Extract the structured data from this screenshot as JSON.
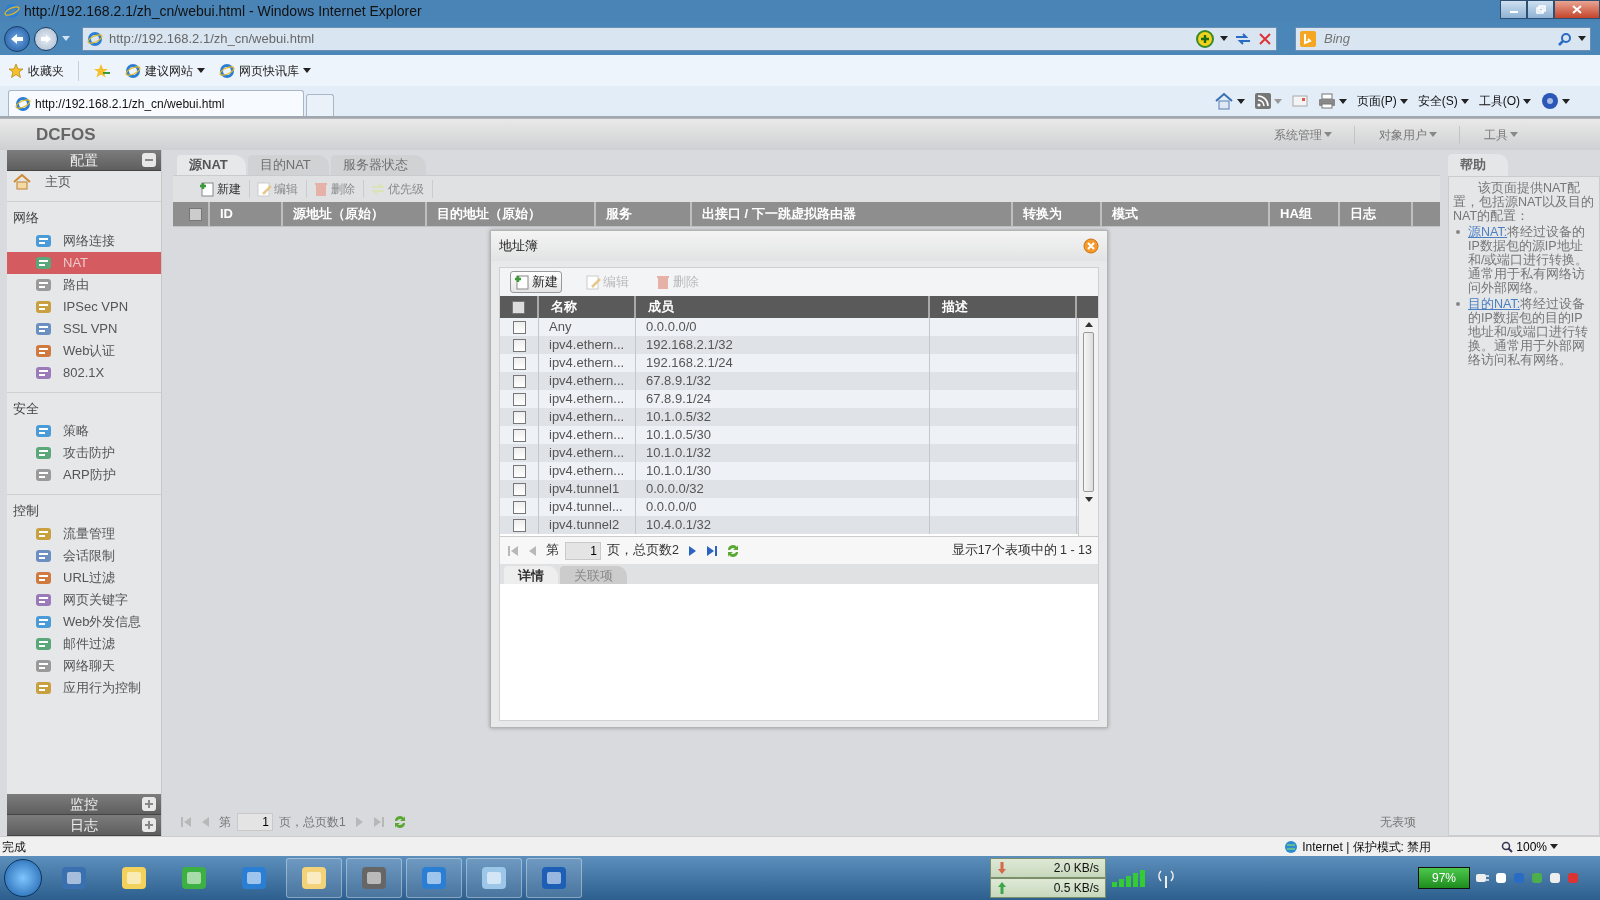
{
  "window": {
    "title": "http://192.168.2.1/zh_cn/webui.html - Windows Internet Explorer"
  },
  "address_bar": {
    "url": "http://192.168.2.1/zh_cn/webui.html"
  },
  "search": {
    "placeholder": "Bing"
  },
  "favorites_bar": [
    {
      "label": "收藏夹",
      "dropdown": false
    },
    {
      "label": "建议网站",
      "dropdown": true
    },
    {
      "label": "网页快讯库",
      "dropdown": true
    }
  ],
  "browser_tabs": [
    {
      "label": "http://192.168.2.1/zh_cn/webui.html",
      "selected": true
    }
  ],
  "command_bar": [
    "页面(P)",
    "安全(S)",
    "工具(O)"
  ],
  "app": {
    "logo": "DCFOS",
    "menus": [
      "系统管理",
      "对象用户",
      "工具"
    ]
  },
  "sidebar": {
    "panels": [
      {
        "title": "配置",
        "expanded": true,
        "home": "主页",
        "groups": [
          {
            "title": "网络",
            "items": [
              {
                "label": "网络连接",
                "selected": false
              },
              {
                "label": "NAT",
                "selected": true
              },
              {
                "label": "路由",
                "selected": false
              },
              {
                "label": "IPSec VPN",
                "selected": false
              },
              {
                "label": "SSL VPN",
                "selected": false
              },
              {
                "label": "Web认证",
                "selected": false
              },
              {
                "label": "802.1X",
                "selected": false
              }
            ]
          },
          {
            "title": "安全",
            "items": [
              {
                "label": "策略",
                "selected": false
              },
              {
                "label": "攻击防护",
                "selected": false
              },
              {
                "label": "ARP防护",
                "selected": false
              }
            ]
          },
          {
            "title": "控制",
            "items": [
              {
                "label": "流量管理",
                "selected": false
              },
              {
                "label": "会话限制",
                "selected": false
              },
              {
                "label": "URL过滤",
                "selected": false
              },
              {
                "label": "网页关键字",
                "selected": false
              },
              {
                "label": "Web外发信息",
                "selected": false
              },
              {
                "label": "邮件过滤",
                "selected": false
              },
              {
                "label": "网络聊天",
                "selected": false
              },
              {
                "label": "应用行为控制",
                "selected": false
              }
            ]
          }
        ]
      },
      {
        "title": "监控",
        "expanded": false
      },
      {
        "title": "日志",
        "expanded": false
      }
    ]
  },
  "tabs": [
    {
      "label": "源NAT",
      "selected": true
    },
    {
      "label": "目的NAT",
      "selected": false
    },
    {
      "label": "服务器状态",
      "selected": false
    }
  ],
  "toolbar": [
    {
      "label": "新建",
      "disabled": false
    },
    {
      "label": "编辑",
      "disabled": true
    },
    {
      "label": "删除",
      "disabled": true
    },
    {
      "label": "优先级",
      "disabled": true
    }
  ],
  "table": {
    "select_all_checked": false,
    "columns": [
      "ID",
      "源地址（原始）",
      "目的地址（原始）",
      "服务",
      "出接口 / 下一跳虚拟路由器",
      "转换为",
      "模式",
      "HA组",
      "日志"
    ]
  },
  "pager": {
    "prefix": "第",
    "page": "1",
    "suffix": "页，总页数1",
    "summary": "无表项",
    "nav": [
      {
        "kind": "first",
        "disabled": true
      },
      {
        "kind": "prev",
        "disabled": true
      },
      {
        "kind": "next",
        "disabled": true
      },
      {
        "kind": "last",
        "disabled": true
      }
    ]
  },
  "help": {
    "title": "帮助",
    "intro": "该页面提供NAT配置，包括源NAT以及目的NAT的配置：",
    "items": [
      {
        "link": "源NAT:",
        "text": "将经过设备的IP数据包的源IP地址和/或端口进行转换。通常用于私有网络访问外部网络。"
      },
      {
        "link": "目的NAT:",
        "text": "将经过设备的IP数据包的目的IP地址和/或端口进行转换。通常用于外部网络访问私有网络。"
      }
    ]
  },
  "dialog": {
    "title": "地址簿",
    "toolbar": [
      {
        "label": "新建",
        "disabled": false
      },
      {
        "label": "编辑",
        "disabled": true
      },
      {
        "label": "删除",
        "disabled": true
      }
    ],
    "select_all_checked": false,
    "columns": [
      "名称",
      "成员",
      "描述"
    ],
    "rows": [
      {
        "name": "Any",
        "member": "0.0.0.0/0",
        "checked": false
      },
      {
        "name": "ipv4.ethern...",
        "member": "192.168.2.1/32",
        "checked": false
      },
      {
        "name": "ipv4.ethern...",
        "member": "192.168.2.1/24",
        "checked": false
      },
      {
        "name": "ipv4.ethern...",
        "member": "67.8.9.1/32",
        "checked": false
      },
      {
        "name": "ipv4.ethern...",
        "member": "67.8.9.1/24",
        "checked": false
      },
      {
        "name": "ipv4.ethern...",
        "member": "10.1.0.5/32",
        "checked": false
      },
      {
        "name": "ipv4.ethern...",
        "member": "10.1.0.5/30",
        "checked": false
      },
      {
        "name": "ipv4.ethern...",
        "member": "10.1.0.1/32",
        "checked": false
      },
      {
        "name": "ipv4.ethern...",
        "member": "10.1.0.1/30",
        "checked": false
      },
      {
        "name": "ipv4.tunnel1",
        "member": "0.0.0.0/32",
        "checked": false
      },
      {
        "name": "ipv4.tunnel...",
        "member": "0.0.0.0/0",
        "checked": false
      },
      {
        "name": "ipv4.tunnel2",
        "member": "10.4.0.1/32",
        "checked": false
      }
    ],
    "pager": {
      "prefix": "第",
      "page": "1",
      "suffix": "页，总页数2",
      "summary": "显示17个表项中的 1 - 13",
      "nav": [
        {
          "kind": "first",
          "disabled": true
        },
        {
          "kind": "prev",
          "disabled": true
        },
        {
          "kind": "next",
          "disabled": false
        },
        {
          "kind": "last",
          "disabled": false
        }
      ]
    },
    "tabs": [
      {
        "label": "详情",
        "selected": true
      },
      {
        "label": "关联项",
        "selected": false
      }
    ]
  },
  "status_bar": {
    "text": "完成",
    "zone": "Internet | 保护模式: 禁用",
    "zoom": "100%"
  },
  "taskbar": {
    "download": "2.0 KB/s",
    "upload": "0.5 KB/s",
    "battery": "97%"
  }
}
